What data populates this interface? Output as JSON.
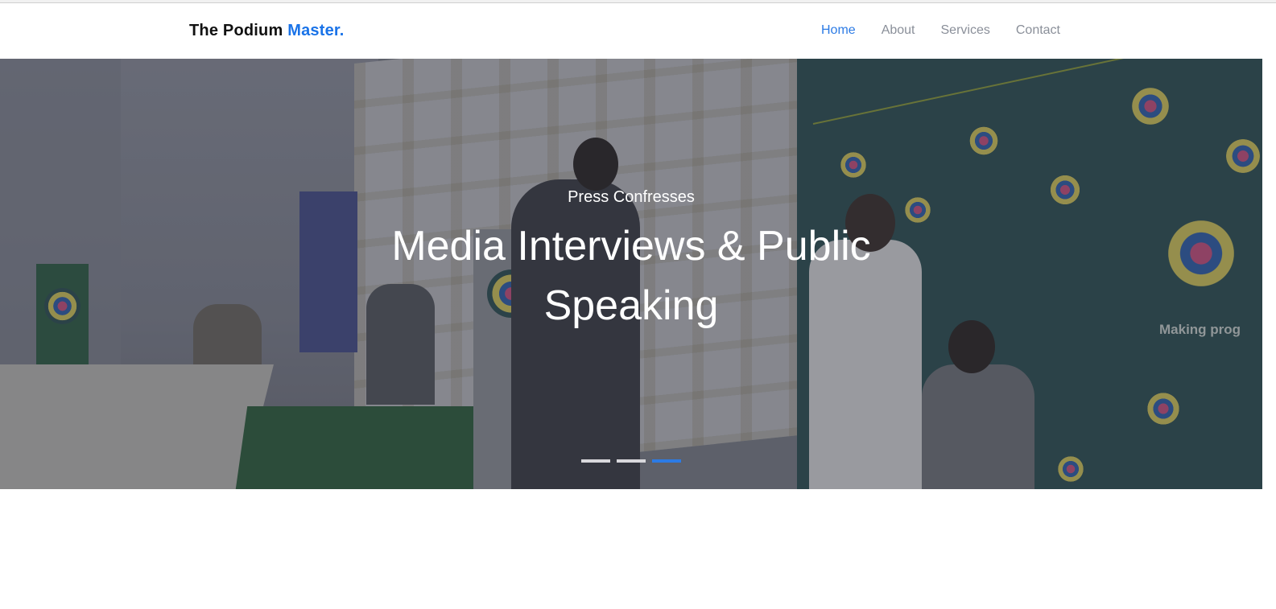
{
  "navbar": {
    "brand_prefix": "The Podium",
    "brand_accent": "Master.",
    "links": [
      {
        "label": "Home",
        "active": true
      },
      {
        "label": "About",
        "active": false
      },
      {
        "label": "Services",
        "active": false
      },
      {
        "label": "Contact",
        "active": false
      }
    ]
  },
  "hero": {
    "subtitle": "Press Confresses",
    "title": "Media Interviews & Public Speaking",
    "background_text": "Making prog",
    "slides_count": 3,
    "active_slide": 3
  },
  "colors": {
    "accent": "#2c7be5",
    "nav_text": "#8a8f99",
    "brand_text": "#111111"
  }
}
